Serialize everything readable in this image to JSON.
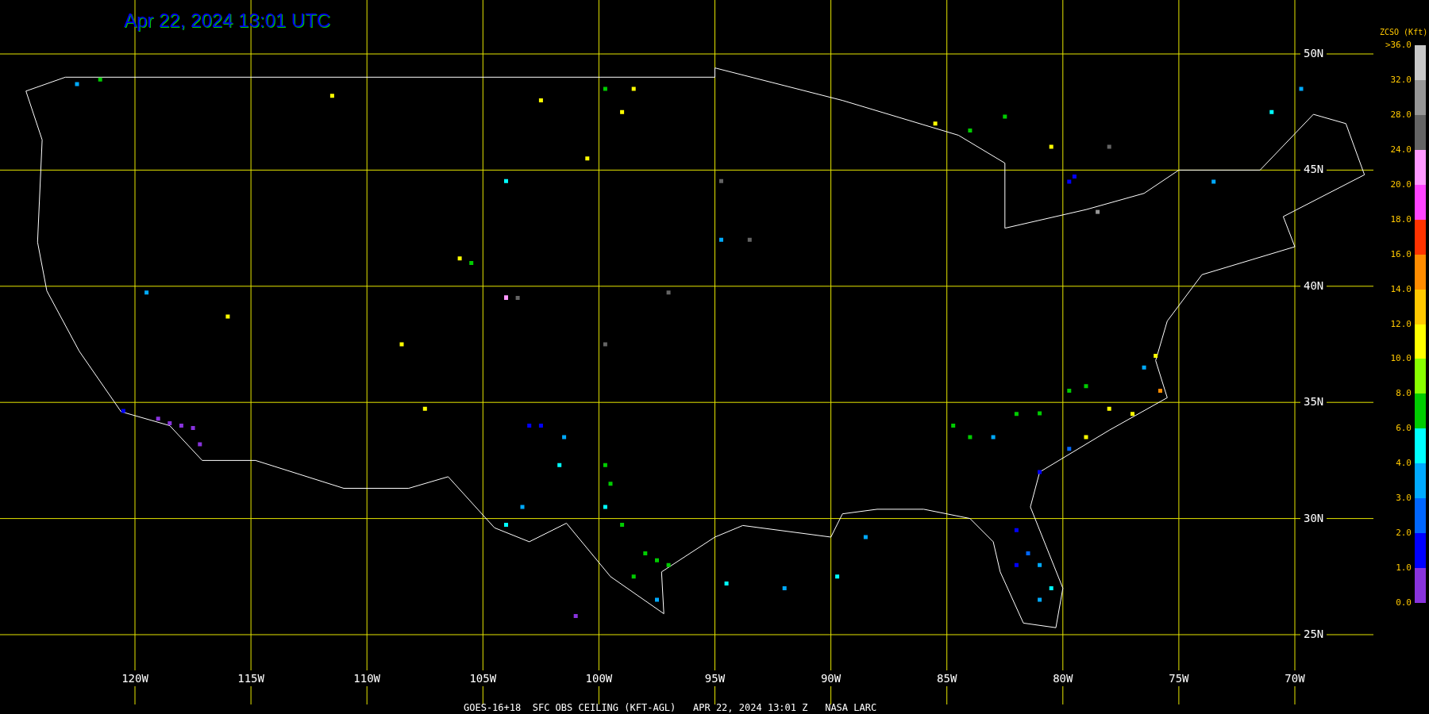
{
  "title": "Apr 22, 2024 13:01 UTC",
  "map": {
    "longitude_labels": [
      "120W",
      "115W",
      "110W",
      "105W",
      "100W",
      "95W",
      "90W",
      "85W",
      "80W",
      "75W",
      "70W"
    ],
    "latitude_labels": [
      "50N",
      "45N",
      "40N",
      "35N",
      "30N",
      "25N"
    ]
  },
  "legend": {
    "title": "ZCSO (Kft)",
    "labels": [
      ">36.0",
      "32.0",
      "28.0",
      "24.0",
      "20.0",
      "18.0",
      "16.0",
      "14.0",
      "12.0",
      "10.0",
      "8.0",
      "6.0",
      "4.0",
      "3.0",
      "2.0",
      "1.0",
      "0.0"
    ],
    "swatches": [
      {
        "color": "#c8c8c8"
      },
      {
        "color": "#969696"
      },
      {
        "color": "#646464"
      },
      {
        "color": "#ff99ff"
      },
      {
        "color": "#ff44ff"
      },
      {
        "color": "#ff3300"
      },
      {
        "color": "#ff8c00"
      },
      {
        "color": "#ffc800"
      },
      {
        "color": "#ffff00"
      },
      {
        "color": "#88ff00"
      },
      {
        "color": "#00cc00"
      },
      {
        "color": "#00ffff"
      },
      {
        "color": "#00aaff"
      },
      {
        "color": "#0066ff"
      },
      {
        "color": "#0000ff"
      },
      {
        "color": "#8833dd"
      }
    ]
  },
  "footer": "GOES-16+18  SFC OBS CEILING (KFT-AGL)   APR 22, 2024 13:01 Z   NASA LARC"
}
